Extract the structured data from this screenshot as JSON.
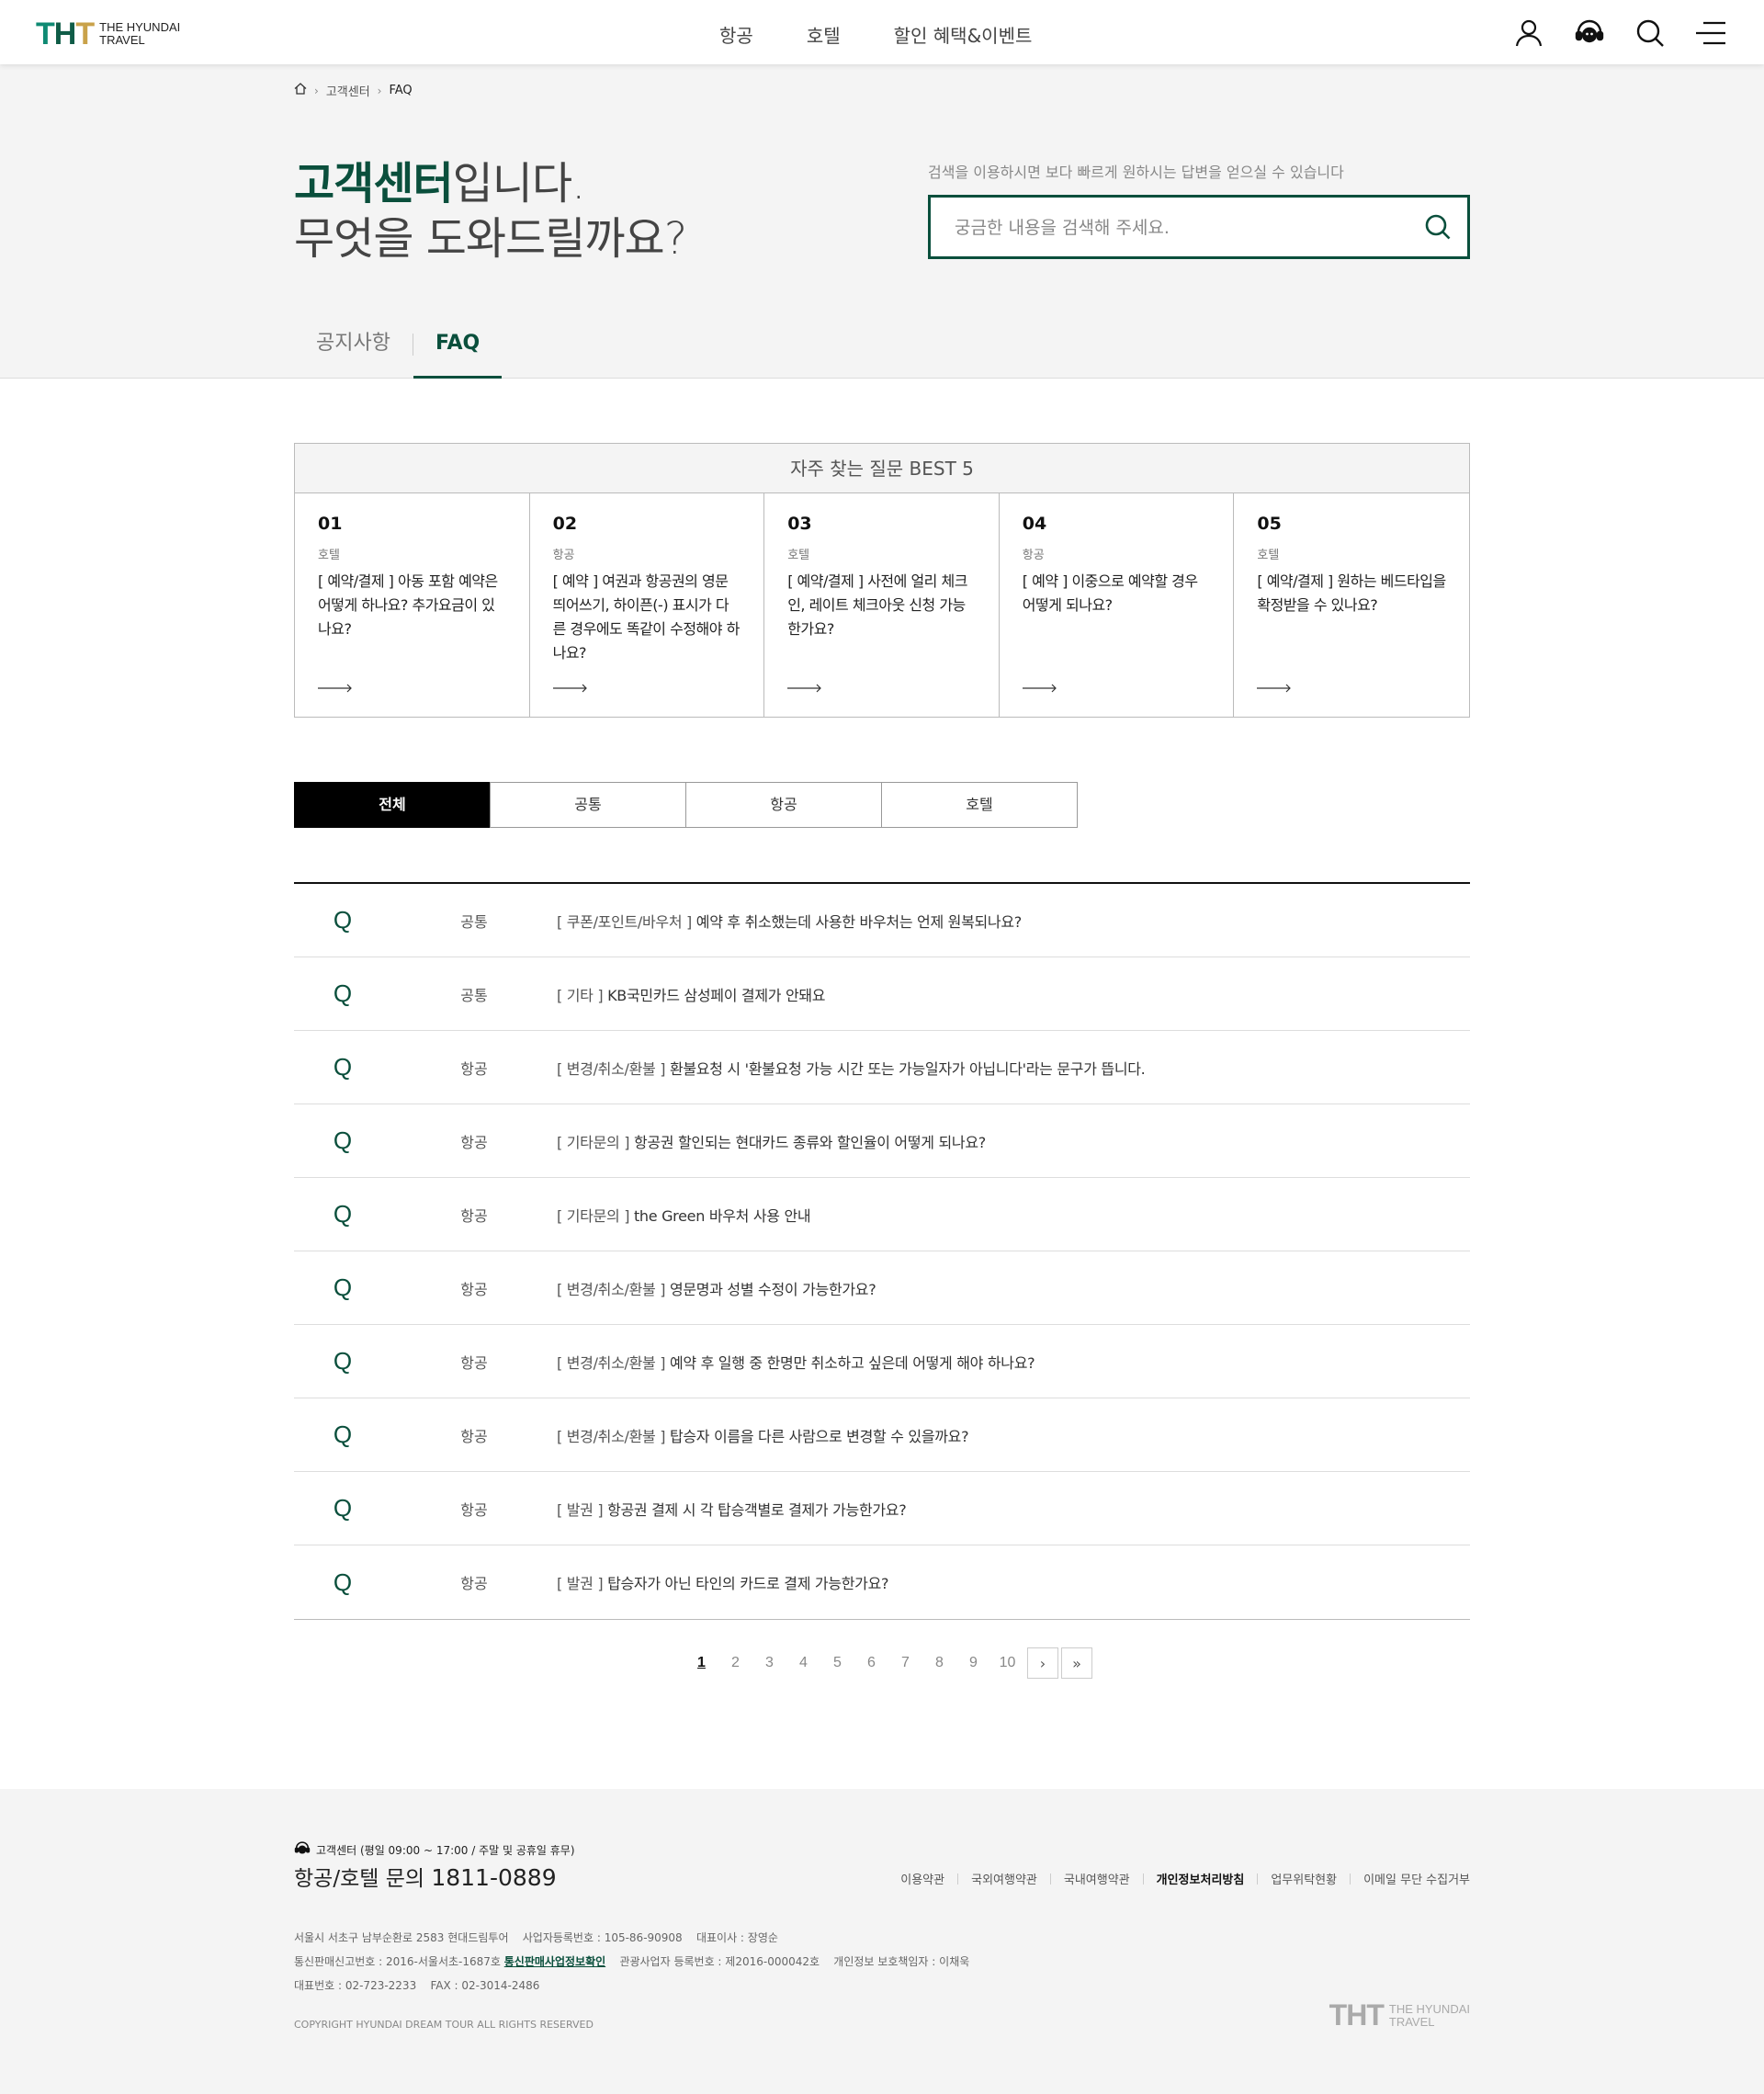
{
  "header": {
    "logo_mark": [
      "T",
      "H",
      "T"
    ],
    "logo_line1": "THE HYUNDAI",
    "logo_line2": "TRAVEL",
    "nav": [
      "항공",
      "호텔",
      "할인 혜택&이벤트"
    ]
  },
  "breadcrumb": {
    "items": [
      "고객센터",
      "FAQ"
    ]
  },
  "hero": {
    "title_strong": "고객센터",
    "title_rest": "입니다.",
    "title_line2": "무엇을 도와드릴까요?",
    "search_guide": "검색을 이용하시면 보다 빠르게 원하시는 답변을 얻으실 수 있습니다",
    "search_placeholder": "궁금한 내용을 검색해 주세요."
  },
  "tabs": [
    "공지사항",
    "FAQ"
  ],
  "best": {
    "heading": "자주 찾는 질문 BEST 5",
    "items": [
      {
        "num": "01",
        "cat": "호텔",
        "q": "[ 예약/결제 ] 아동 포함 예약은 어떻게 하나요? 추가요금이 있나요?"
      },
      {
        "num": "02",
        "cat": "항공",
        "q": "[ 예약 ] 여권과 항공권의 영문 띄어쓰기, 하이픈(-) 표시가 다른 경우에도 똑같이 수정해야 하나요?"
      },
      {
        "num": "03",
        "cat": "호텔",
        "q": "[ 예약/결제 ] 사전에 얼리 체크인, 레이트 체크아웃 신청 가능한가요?"
      },
      {
        "num": "04",
        "cat": "항공",
        "q": "[ 예약 ] 이중으로 예약할 경우 어떻게 되나요?"
      },
      {
        "num": "05",
        "cat": "호텔",
        "q": "[ 예약/결제 ] 원하는 베드타입을 확정받을 수 있나요?"
      }
    ]
  },
  "categories": [
    "전체",
    "공통",
    "항공",
    "호텔"
  ],
  "faq": {
    "q_mark": "Q",
    "rows": [
      {
        "cat": "공통",
        "tag": "[ 쿠폰/포인트/바우처 ]",
        "text": "예약 후 취소했는데 사용한 바우처는 언제 원복되나요?"
      },
      {
        "cat": "공통",
        "tag": "[ 기타 ]",
        "text": "KB국민카드 삼성페이 결제가 안돼요"
      },
      {
        "cat": "항공",
        "tag": "[ 변경/취소/환불 ]",
        "text": "환불요청 시 '환불요청 가능 시간 또는 가능일자가 아닙니다'라는 문구가 뜹니다."
      },
      {
        "cat": "항공",
        "tag": "[ 기타문의 ]",
        "text": "항공권 할인되는 현대카드 종류와 할인율이 어떻게 되나요?"
      },
      {
        "cat": "항공",
        "tag": "[ 기타문의 ]",
        "text": "the Green 바우처 사용 안내"
      },
      {
        "cat": "항공",
        "tag": "[ 변경/취소/환불 ]",
        "text": "영문명과 성별 수정이 가능한가요?"
      },
      {
        "cat": "항공",
        "tag": "[ 변경/취소/환불 ]",
        "text": "예약 후 일행 중 한명만 취소하고 싶은데 어떻게 해야 하나요?"
      },
      {
        "cat": "항공",
        "tag": "[ 변경/취소/환불 ]",
        "text": "탑승자 이름을 다른 사람으로 변경할 수 있을까요?"
      },
      {
        "cat": "항공",
        "tag": "[ 발권 ]",
        "text": "항공권 결제 시 각 탑승객별로 결제가 가능한가요?"
      },
      {
        "cat": "항공",
        "tag": "[ 발권 ]",
        "text": "탑승자가 아닌 타인의 카드로 결제 가능한가요?"
      }
    ]
  },
  "pagination": {
    "pages": [
      "1",
      "2",
      "3",
      "4",
      "5",
      "6",
      "7",
      "8",
      "9",
      "10"
    ],
    "current": "1",
    "next": "›",
    "last": "»"
  },
  "footer": {
    "cs_label": "고객센터 (평일 09:00 ~ 17:00 / 주말 및 공휴일 휴무)",
    "phone_label": "항공/호텔 문의",
    "phone_number": "1811-0889",
    "links": [
      "이용약관",
      "국외여행약관",
      "국내여행약관",
      "개인정보처리방침",
      "업무위탁현황",
      "이메일 무단 수집거부"
    ],
    "info1": "서울시 서초구 남부순환로 2583 현대드림투어    사업자등록번호 : 105-86-90908    대표이사 : 장영순",
    "info2_pre": "통신판매신고번호 : 2016-서울서초-1687호",
    "info2_link": "통신판매사업정보확인",
    "info2_post": "관광사업자 등록번호 : 제2016-000042호    개인정보 보호책임자 : 이채욱",
    "info3": "대표번호 : 02-723-2233    FAX : 02-3014-2486",
    "copyright": "COPYRIGHT HYUNDAI DREAM TOUR ALL RIGHTS RESERVED",
    "logo_mark": "THT",
    "logo_line1": "THE HYUNDAI",
    "logo_line2": "TRAVEL"
  }
}
